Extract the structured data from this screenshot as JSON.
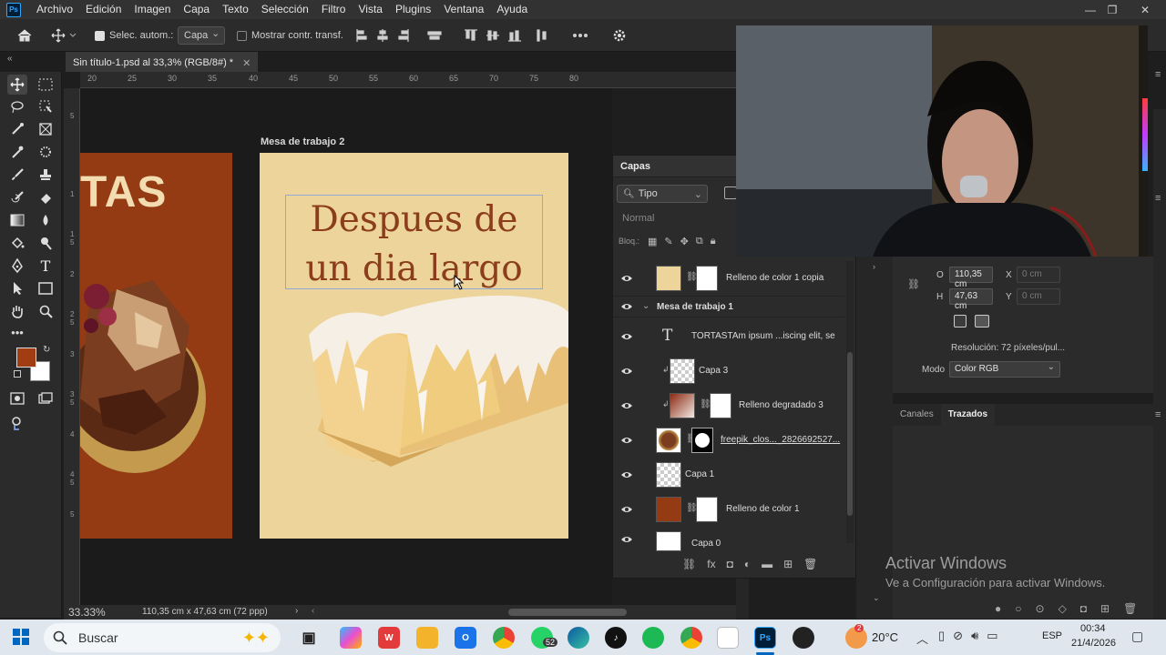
{
  "app": {
    "menu": [
      "Archivo",
      "Edición",
      "Imagen",
      "Capa",
      "Texto",
      "Selección",
      "Filtro",
      "Vista",
      "Plugins",
      "Ventana",
      "Ayuda"
    ],
    "logo": "Ps"
  },
  "options": {
    "auto_select_label": "Selec. autom.:",
    "auto_select_value": "Capa",
    "transform_controls_label": "Mostrar contr. transf."
  },
  "document": {
    "tab_title": "Sin título-1.psd al 33,3% (RGB/8#) *",
    "zoom": "33.33%",
    "doc_size": "110,35 cm x 47,63 cm (72 ppp)"
  },
  "ruler": {
    "top": [
      "20",
      "25",
      "30",
      "35",
      "40",
      "45",
      "50",
      "55",
      "60",
      "65",
      "70",
      "75",
      "80"
    ],
    "left": [
      "5",
      "1",
      "1 5",
      "2",
      "2 5",
      "3",
      "3 5",
      "4",
      "4 5",
      "5"
    ]
  },
  "canvas": {
    "artboard1_text": "TAS",
    "artboard2_label": "Mesa de trabajo 2",
    "headline": "Despues de un dia largo"
  },
  "layers": {
    "title": "Capas",
    "filter": "Tipo",
    "blend": "Normal",
    "lock_label": "Bloq.:",
    "rows": [
      {
        "name": "Relleno de color 1 copia"
      },
      {
        "name": "Mesa de trabajo 1"
      },
      {
        "name": "TORTASTAm ipsum ...iscing elit, se"
      },
      {
        "name": "Capa 3"
      },
      {
        "name": "Relleno degradado 3"
      },
      {
        "name": "freepik_clos..._2826692527..."
      },
      {
        "name": "Capa 1"
      },
      {
        "name": "Relleno de color 1"
      },
      {
        "name": "Capa 0"
      }
    ]
  },
  "properties": {
    "w_label": "O",
    "w_value": "110,35 cm",
    "x_label": "X",
    "x_value": "0 cm",
    "h_label": "H",
    "h_value": "47,63 cm",
    "y_label": "Y",
    "y_value": "0 cm",
    "resolution": "Resolución: 72 píxeles/pul...",
    "mode_label": "Modo",
    "mode_value": "Color RGB"
  },
  "paths_panel": {
    "tabs": [
      "Canales",
      "Trazados"
    ]
  },
  "watermark": {
    "title": "Activar Windows",
    "subtitle": "Ve a Configuración para activar Windows."
  },
  "taskbar": {
    "search_placeholder": "Buscar",
    "whatsapp_badge": "52",
    "weather_badge": "2",
    "temperature": "20°C",
    "language": "ESP",
    "time": "00:34",
    "date": "21/4/2026"
  }
}
